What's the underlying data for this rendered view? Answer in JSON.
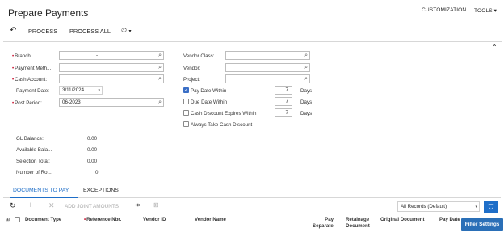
{
  "header": {
    "title": "Prepare Payments",
    "customization_label": "CUSTOMIZATION",
    "tools_label": "TOOLS"
  },
  "toolbar": {
    "process_label": "PROCESS",
    "process_all_label": "PROCESS ALL"
  },
  "filters": {
    "branch_label": "Branch:",
    "branch_value": "-",
    "payment_method_label": "Payment Meth...",
    "payment_method_value": "",
    "cash_account_label": "Cash Account:",
    "cash_account_value": "",
    "payment_date_label": "Payment Date:",
    "payment_date_value": "3/11/2024",
    "post_period_label": "Post Period:",
    "post_period_value": "06-2023",
    "vendor_class_label": "Vendor Class:",
    "vendor_label": "Vendor:",
    "project_label": "Project:",
    "pay_date_within_label": "Pay Date Within",
    "pay_date_within_checked": true,
    "pay_date_within_days": "7",
    "due_date_within_label": "Due Date Within",
    "due_date_within_checked": false,
    "due_date_within_days": "7",
    "cash_discount_label": "Cash Discount Expires Within",
    "cash_discount_checked": false,
    "cash_discount_days": "7",
    "always_take_discount_label": "Always Take Cash Discount",
    "always_take_discount_checked": false,
    "days_label": "Days"
  },
  "balances": {
    "gl_balance_label": "GL Balance:",
    "gl_balance_value": "0.00",
    "available_balance_label": "Available Bala...",
    "available_balance_value": "0.00",
    "selection_total_label": "Selection Total:",
    "selection_total_value": "0.00",
    "number_of_rows_label": "Number of Ro...",
    "number_of_rows_value": "0"
  },
  "tabs": [
    {
      "label": "DOCUMENTS TO PAY",
      "active": true
    },
    {
      "label": "EXCEPTIONS",
      "active": false
    }
  ],
  "grid": {
    "add_joint_amounts_label": "ADD JOINT AMOUNTS",
    "records_select_value": "All Records (Default)",
    "columns": [
      "Document Type",
      "Reference Nbr.",
      "Vendor ID",
      "Vendor Name",
      "Pay Separately",
      "Retainage Document",
      "Original Document",
      "Pay Date"
    ],
    "filter_settings_tooltip": "Filter Settings"
  },
  "colors": {
    "accent": "#1e6ec8",
    "required": "#c8102e"
  }
}
